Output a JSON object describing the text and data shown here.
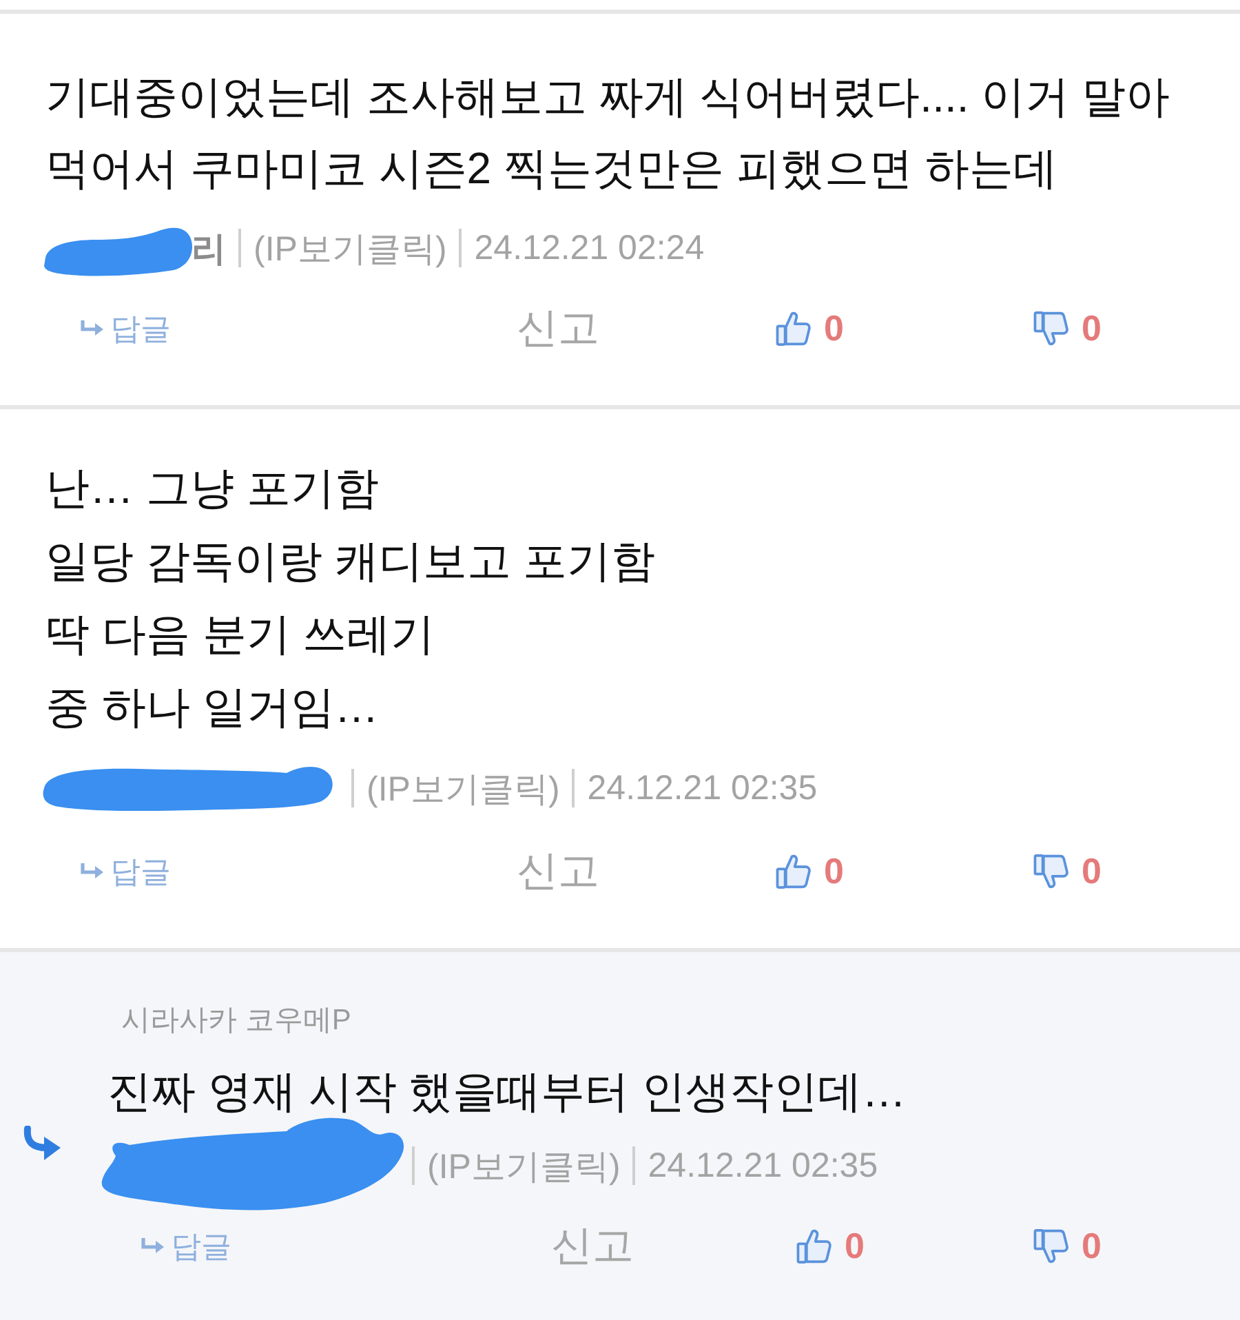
{
  "comments": [
    {
      "kind": "comment",
      "text": "기대중이었는데 조사해보고 짜게 식어버렸다.... 이거 말아 먹어서 쿠마미코 시즌2 찍는것만은 피했으면 하는데",
      "author_redacted": true,
      "author_visible_part": "리",
      "ip_link": "(IP보기클릭)",
      "date": "24.12.21 02:24",
      "reply_label": "답글",
      "report_label": "신고",
      "likes": "0",
      "dislikes": "0"
    },
    {
      "kind": "comment",
      "text": "난… 그냥 포기함\n일당 감독이랑 캐디보고 포기함\n딱 다음 분기 쓰레기\n중 하나 일거임…",
      "author_redacted": true,
      "ip_link": "(IP보기클릭)",
      "date": "24.12.21 02:35",
      "reply_label": "답글",
      "report_label": "신고",
      "likes": "0",
      "dislikes": "0"
    },
    {
      "kind": "reply",
      "reply_to": "시라사카 코우메P",
      "text": "진짜 영재 시작 했을때부터 인생작인데…",
      "author_redacted": true,
      "ip_link": "(IP보기클릭)",
      "date": "24.12.21 02:35",
      "reply_label": "답글",
      "report_label": "신고",
      "likes": "0",
      "dislikes": "0"
    }
  ]
}
